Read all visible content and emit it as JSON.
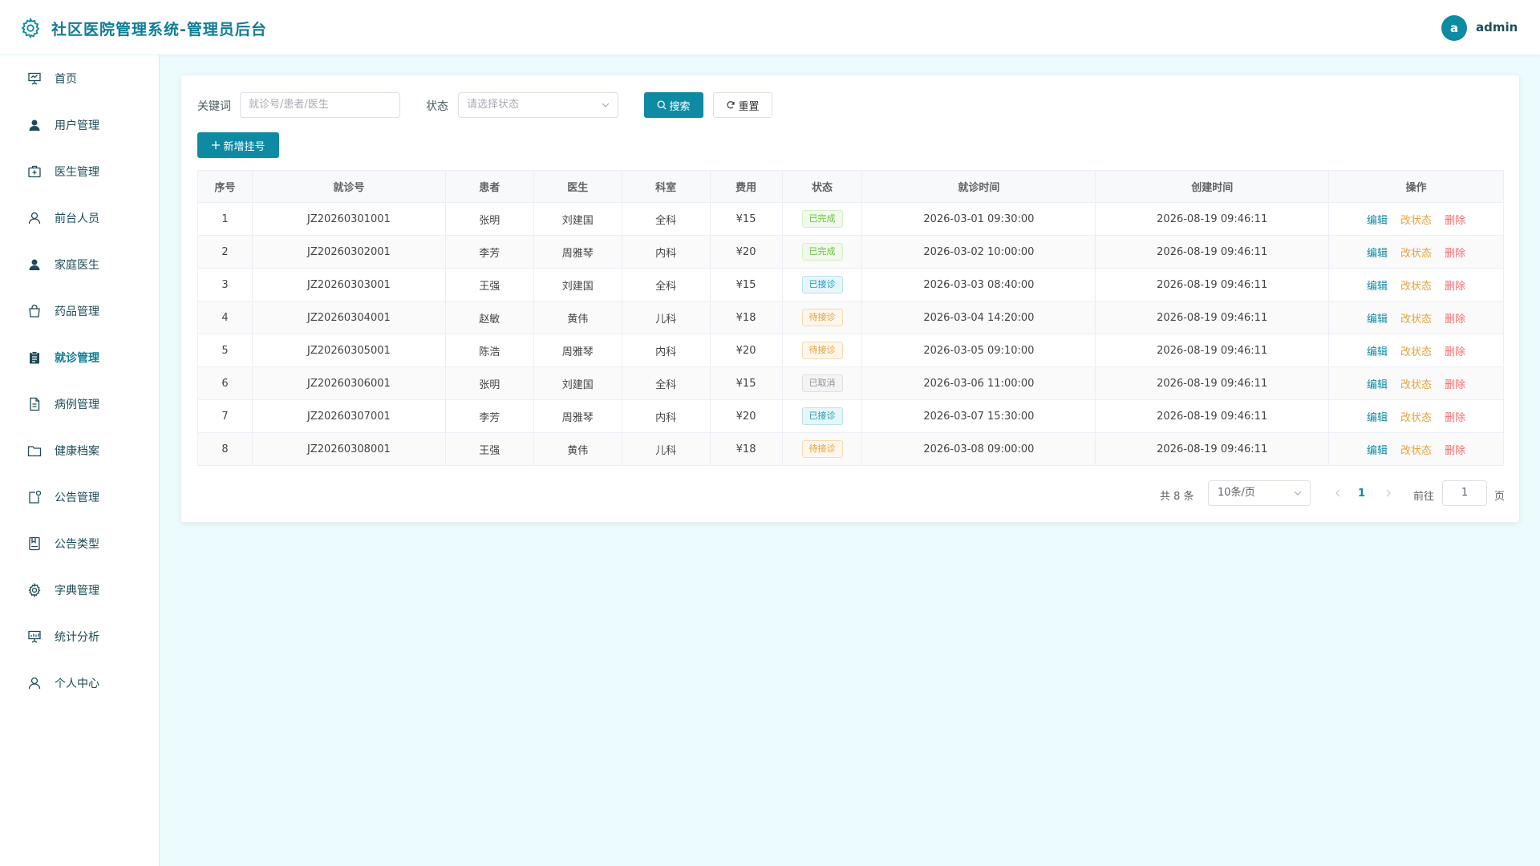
{
  "header": {
    "title": "社区医院管理系统-管理员后台",
    "avatar_letter": "a",
    "username": "admin"
  },
  "sidebar": {
    "items": [
      {
        "label": "首页",
        "icon": "presentation-icon"
      },
      {
        "label": "用户管理",
        "icon": "user-solid-icon"
      },
      {
        "label": "医生管理",
        "icon": "first-aid-kit-icon"
      },
      {
        "label": "前台人员",
        "icon": "user-outline-icon"
      },
      {
        "label": "家庭医生",
        "icon": "user-solid-icon"
      },
      {
        "label": "药品管理",
        "icon": "shopping-bag-icon"
      },
      {
        "label": "就诊管理",
        "icon": "clipboard-icon"
      },
      {
        "label": "病例管理",
        "icon": "document-icon"
      },
      {
        "label": "健康档案",
        "icon": "folder-icon"
      },
      {
        "label": "公告管理",
        "icon": "notice-icon"
      },
      {
        "label": "公告类型",
        "icon": "notebook-icon"
      },
      {
        "label": "字典管理",
        "icon": "gear-icon"
      },
      {
        "label": "统计分析",
        "icon": "chart-board-icon"
      },
      {
        "label": "个人中心",
        "icon": "user-outline-icon"
      }
    ],
    "active_index": 6
  },
  "filters": {
    "keyword_label": "关键词",
    "keyword_placeholder": "就诊号/患者/医生",
    "status_label": "状态",
    "status_placeholder": "请选择状态",
    "search_label": "搜索",
    "reset_label": "重置",
    "add_label": "新增挂号"
  },
  "table": {
    "columns": [
      "序号",
      "就诊号",
      "患者",
      "医生",
      "科室",
      "费用",
      "状态",
      "就诊时间",
      "创建时间",
      "操作"
    ],
    "rows": [
      {
        "no": "1",
        "visit_no": "JZ20260301001",
        "patient": "张明",
        "doctor": "刘建国",
        "dept": "全科",
        "fee": "¥15",
        "status": "已完成",
        "status_type": "done",
        "visit_time": "2026-03-01 09:30:00",
        "created": "2026-08-19 09:46:11"
      },
      {
        "no": "2",
        "visit_no": "JZ20260302001",
        "patient": "李芳",
        "doctor": "周雅琴",
        "dept": "内科",
        "fee": "¥20",
        "status": "已完成",
        "status_type": "done",
        "visit_time": "2026-03-02 10:00:00",
        "created": "2026-08-19 09:46:11"
      },
      {
        "no": "3",
        "visit_no": "JZ20260303001",
        "patient": "王强",
        "doctor": "刘建国",
        "dept": "全科",
        "fee": "¥15",
        "status": "已接诊",
        "status_type": "received",
        "visit_time": "2026-03-03 08:40:00",
        "created": "2026-08-19 09:46:11"
      },
      {
        "no": "4",
        "visit_no": "JZ20260304001",
        "patient": "赵敏",
        "doctor": "黄伟",
        "dept": "儿科",
        "fee": "¥18",
        "status": "待接诊",
        "status_type": "waiting",
        "visit_time": "2026-03-04 14:20:00",
        "created": "2026-08-19 09:46:11"
      },
      {
        "no": "5",
        "visit_no": "JZ20260305001",
        "patient": "陈浩",
        "doctor": "周雅琴",
        "dept": "内科",
        "fee": "¥20",
        "status": "待接诊",
        "status_type": "waiting",
        "visit_time": "2026-03-05 09:10:00",
        "created": "2026-08-19 09:46:11"
      },
      {
        "no": "6",
        "visit_no": "JZ20260306001",
        "patient": "张明",
        "doctor": "刘建国",
        "dept": "全科",
        "fee": "¥15",
        "status": "已取消",
        "status_type": "cancel",
        "visit_time": "2026-03-06 11:00:00",
        "created": "2026-08-19 09:46:11"
      },
      {
        "no": "7",
        "visit_no": "JZ20260307001",
        "patient": "李芳",
        "doctor": "周雅琴",
        "dept": "内科",
        "fee": "¥20",
        "status": "已接诊",
        "status_type": "received",
        "visit_time": "2026-03-07 15:30:00",
        "created": "2026-08-19 09:46:11"
      },
      {
        "no": "8",
        "visit_no": "JZ20260308001",
        "patient": "王强",
        "doctor": "黄伟",
        "dept": "儿科",
        "fee": "¥18",
        "status": "待接诊",
        "status_type": "waiting",
        "visit_time": "2026-03-08 09:00:00",
        "created": "2026-08-19 09:46:11"
      }
    ],
    "actions": {
      "edit": "编辑",
      "change_status": "改状态",
      "delete": "删除"
    }
  },
  "pagination": {
    "total_text": "共 8 条",
    "page_size": "10条/页",
    "current_page": "1",
    "goto_label": "前往",
    "goto_value": "1",
    "page_suffix": "页"
  },
  "colors": {
    "primary": "#0e8aa3",
    "background": "#ecfbfd",
    "done": "#67c23a",
    "waiting": "#e6a23c",
    "danger": "#f56c6c",
    "cancel": "#909399"
  }
}
